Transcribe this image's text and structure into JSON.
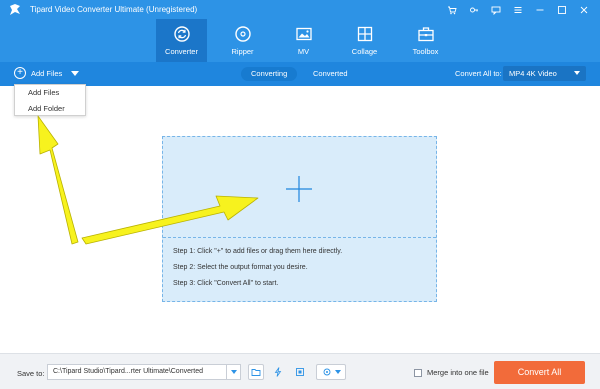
{
  "window": {
    "title": "Tipard Video Converter Ultimate (Unregistered)",
    "controls": [
      "cart-icon",
      "key-icon",
      "feedback-icon",
      "menu-icon",
      "minimize-icon",
      "maximize-icon",
      "close-icon"
    ]
  },
  "nav": {
    "items": [
      {
        "label": "Converter",
        "icon": "converter-icon",
        "active": true
      },
      {
        "label": "Ripper",
        "icon": "ripper-icon",
        "active": false
      },
      {
        "label": "MV",
        "icon": "mv-icon",
        "active": false
      },
      {
        "label": "Collage",
        "icon": "collage-icon",
        "active": false
      },
      {
        "label": "Toolbox",
        "icon": "toolbox-icon",
        "active": false
      }
    ]
  },
  "subbar": {
    "add_files_label": "Add Files",
    "tabs": [
      {
        "label": "Converting",
        "active": true
      },
      {
        "label": "Converted",
        "active": false
      }
    ],
    "convert_all_to_label": "Convert All to:",
    "format_value": "MP4 4K Video"
  },
  "dropdown": {
    "options": [
      "Add Files",
      "Add Folder"
    ]
  },
  "dropzone": {
    "steps": [
      "Step 1: Click \"+\" to add files or drag them here directly.",
      "Step 2: Select the output format you desire.",
      "Step 3: Click \"Convert All\" to start."
    ]
  },
  "bottom": {
    "save_to_label": "Save to:",
    "save_path": "C:\\Tipard Studio\\Tipard...rter Ultimate\\Converted",
    "merge_label": "Merge into one file",
    "merge_checked": false,
    "convert_all_label": "Convert All"
  },
  "colors": {
    "topbar": "#2d93e6",
    "subbar": "#1f86de",
    "active_nav": "#1b76c9",
    "dropzone": "#d9ecfa",
    "convert_button": "#f26b3a",
    "annotation_arrow": "#f7f21e"
  }
}
